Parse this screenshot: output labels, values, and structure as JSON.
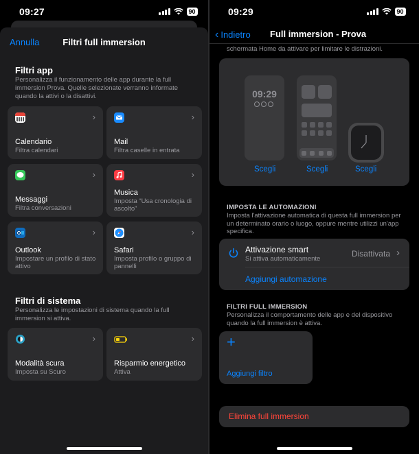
{
  "left": {
    "status": {
      "time": "09:27",
      "battery": "90"
    },
    "header": {
      "cancel_label": "Annulla",
      "title": "Filtri full immersion"
    },
    "app_filters": {
      "title": "Filtri app",
      "description": "Personalizza il funzionamento delle app durante la full immersion Prova. Quelle selezionate verranno informate quando la attivi o la disattivi.",
      "tiles": [
        {
          "title": "Calendario",
          "subtitle": "Filtra calendari",
          "icon": "calendar-icon",
          "color": "#e9453a"
        },
        {
          "title": "Mail",
          "subtitle": "Filtra caselle in entrata",
          "icon": "mail-icon",
          "color": "#1a8cff"
        },
        {
          "title": "Messaggi",
          "subtitle": "Filtra conversazioni",
          "icon": "messages-icon",
          "color": "#34c759"
        },
        {
          "title": "Musica",
          "subtitle": "Imposta “Usa cronologia di ascolto”",
          "icon": "music-icon",
          "color": "#fc3c44"
        },
        {
          "title": "Outlook",
          "subtitle": "Impostare un profilo di stato attivo",
          "icon": "outlook-icon",
          "color": "#0f6cbd"
        },
        {
          "title": "Safari",
          "subtitle": "Imposta profilo o gruppo di pannelli",
          "icon": "safari-icon",
          "color": "#1e90ff"
        }
      ]
    },
    "system_filters": {
      "title": "Filtri di sistema",
      "description": "Personalizza le impostazioni di sistema quando la full immersion si attiva.",
      "tiles": [
        {
          "title": "Modalità scura",
          "subtitle": "Imposta su Scuro",
          "icon": "dark-mode-icon",
          "color": "#2aa3c9"
        },
        {
          "title": "Risparmio energetico",
          "subtitle": "Attiva",
          "icon": "battery-icon",
          "color": "#ffd60a"
        }
      ]
    }
  },
  "right": {
    "status": {
      "time": "09:29",
      "battery": "90"
    },
    "nav": {
      "back_label": "Indietro",
      "title": "Full immersion - Prova"
    },
    "cut_text": "schermata Home da attivare per limitare le distrazioni.",
    "screens": {
      "lock_time": "09:29",
      "choose_labels": [
        "Scegli",
        "Scegli",
        "Scegli"
      ]
    },
    "automations": {
      "caption": "IMPOSTA LE AUTOMAZIONI",
      "description": "Imposta l'attivazione automatica di questa full immersion per un determinato orario o luogo, oppure mentre utilizzi un'app specifica.",
      "smart_title": "Attivazione smart",
      "smart_subtitle": "Si attiva automaticamente",
      "smart_value": "Disattivata",
      "add_label": "Aggiungi automazione"
    },
    "filters": {
      "caption": "FILTRI FULL IMMERSION",
      "description": "Personalizza il comportamento delle app e del dispositivo quando la full immersion è attiva.",
      "add_label": "Aggiungi filtro"
    },
    "delete_label": "Elimina full immersion",
    "accent_color": "#0a84ff",
    "destructive_color": "#ff453a"
  }
}
